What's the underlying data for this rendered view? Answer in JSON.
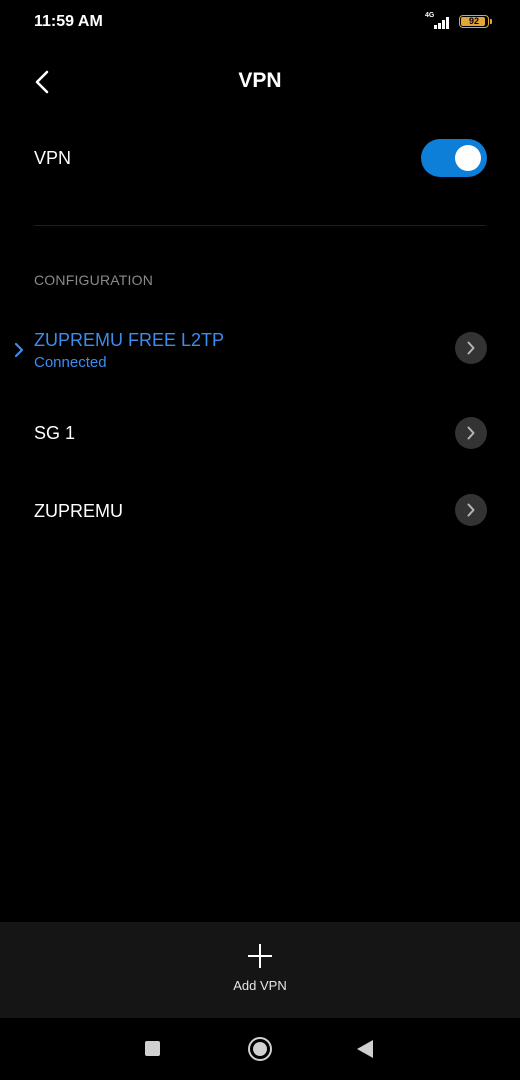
{
  "status_bar": {
    "time": "11:59 AM",
    "network": "4G",
    "battery": "92"
  },
  "header": {
    "title": "VPN",
    "back_icon": "chevron-left-icon"
  },
  "vpn_toggle": {
    "label": "VPN",
    "enabled": true,
    "color": "#0e7fd8"
  },
  "configuration": {
    "header": "CONFIGURATION",
    "items": [
      {
        "name": "ZUPREMU FREE L2TP",
        "status": "Connected",
        "active": true
      },
      {
        "name": "SG 1",
        "status": "",
        "active": false
      },
      {
        "name": "ZUPREMU",
        "status": "",
        "active": false
      }
    ]
  },
  "add_bar": {
    "icon": "plus-icon",
    "label": "Add VPN"
  },
  "colors": {
    "accent": "#3b8df0",
    "background": "#000000",
    "battery": "#e2a63b"
  }
}
